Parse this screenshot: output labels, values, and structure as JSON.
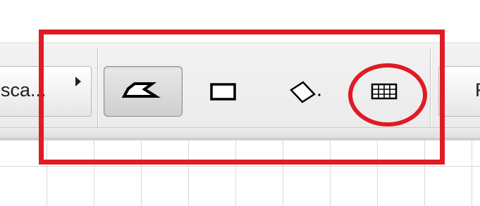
{
  "toolbar": {
    "scale_button_label": "sca...",
    "right_button_label": "F",
    "tools": [
      {
        "id": "freeform",
        "icon": "freeform-selection-icon",
        "pressed": true
      },
      {
        "id": "rectangle",
        "icon": "rectangle-selection-icon",
        "pressed": false
      },
      {
        "id": "rotated",
        "icon": "rotated-rectangle-selection-icon",
        "pressed": false
      },
      {
        "id": "grid",
        "icon": "grid-selection-icon",
        "pressed": false
      }
    ]
  },
  "annotations": {
    "highlight_color": "#e01b24"
  },
  "colors": {
    "toolbar_bg": "#eeeeee",
    "pressed_button_bg": "#d9d9d9",
    "grid_line": "#d8d8d8"
  }
}
